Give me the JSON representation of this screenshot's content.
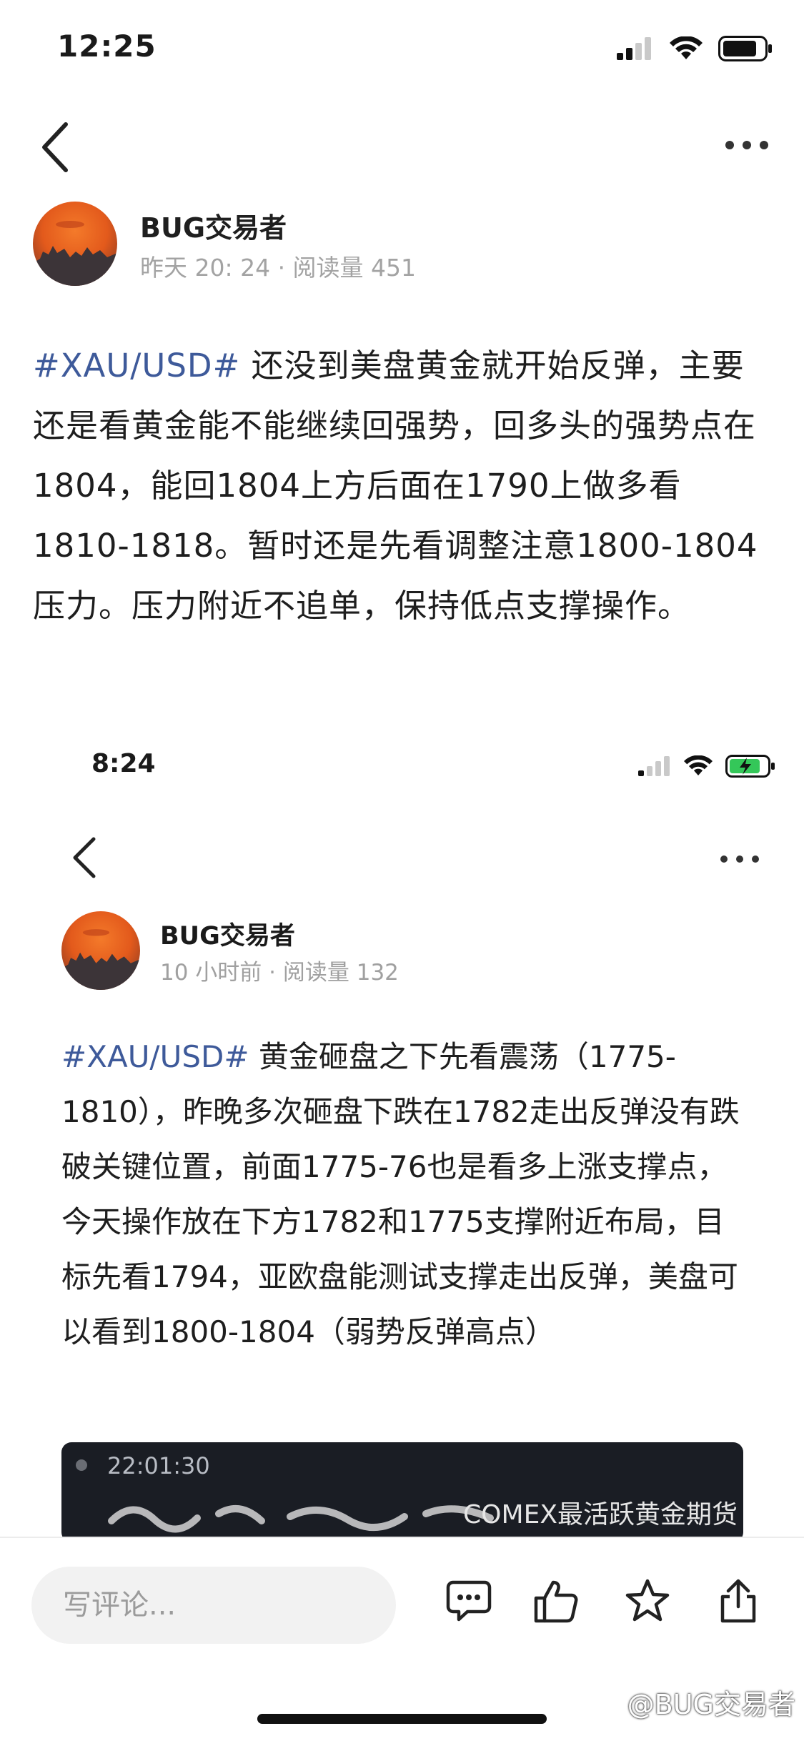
{
  "status_bar": {
    "time": "12:25"
  },
  "post": {
    "author_name": "BUG交易者",
    "meta": "昨天 20: 24 · 阅读量 451",
    "hashtag": "#XAU/USD#",
    "body": " 还没到美盘黄金就开始反弹，主要还是看黄金能不能继续回强势，回多头的强势点在1804，能回1804上方后面在1790上做多看1810-1818。暂时还是先看调整注意1800-1804压力。压力附近不追单，保持低点支撑操作。"
  },
  "embedded_screenshot": {
    "time": "8:24",
    "author_name": "BUG交易者",
    "meta": "10 小时前 · 阅读量 132",
    "hashtag": "#XAU/USD#",
    "body": " 黄金砸盘之下先看震荡（1775-1810），昨晚多次砸盘下跌在1782走出反弹没有跌破关键位置，前面1775-76也是看多上涨支撑点，今天操作放在下方1782和1775支撑附近布局，目标先看1794，亚欧盘能测试支撑走出反弹，美盘可以看到1800-1804（弱势反弹高点）",
    "image_time": "22:01:30",
    "image_label": "COMEX最活跃黄金期货"
  },
  "bottom_bar": {
    "comment_placeholder": "写评论...",
    "watermark": "@BUG交易者"
  },
  "colors": {
    "hashtag": "#3e5a9a",
    "meta": "#a3a3a3"
  },
  "icons": [
    "back-icon",
    "more-icon",
    "signal-icon",
    "wifi-icon",
    "battery-icon",
    "comment-icon",
    "like-icon",
    "star-icon",
    "share-icon"
  ]
}
